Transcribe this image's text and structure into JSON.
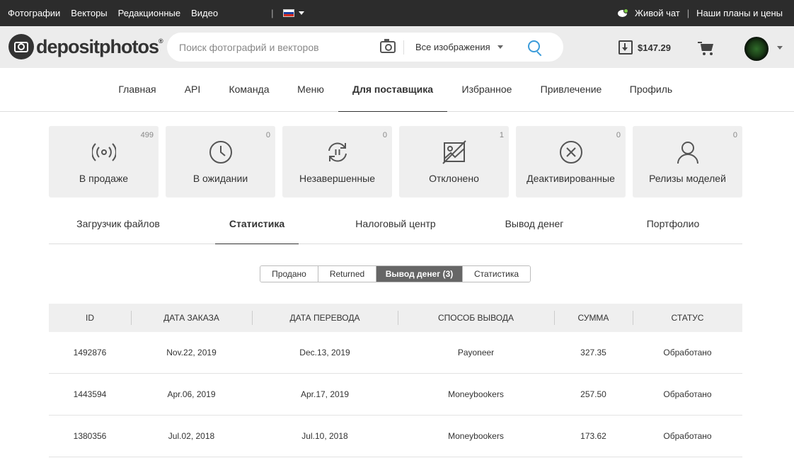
{
  "topbar": {
    "links": [
      "Фотографии",
      "Векторы",
      "Редакционные",
      "Видео"
    ],
    "chat_label": "Живой чат",
    "plans_label": "Наши планы и цены"
  },
  "header": {
    "logo_text": "depositphotos",
    "logo_reg": "®",
    "search_placeholder": "Поиск фотографий и векторов",
    "filter_label": "Все изображения",
    "balance": "$147.29"
  },
  "main_nav": [
    "Главная",
    "API",
    "Команда",
    "Меню",
    "Для поставщика",
    "Избранное",
    "Привлечение",
    "Профиль"
  ],
  "main_nav_active": "Для поставщика",
  "cards": [
    {
      "label": "В продаже",
      "count": "499",
      "icon": "broadcast-icon"
    },
    {
      "label": "В ожидании",
      "count": "0",
      "icon": "clock-icon"
    },
    {
      "label": "Незавершенные",
      "count": "0",
      "icon": "sync-pause-icon"
    },
    {
      "label": "Отклонено",
      "count": "1",
      "icon": "rejected-image-icon"
    },
    {
      "label": "Деактивированные",
      "count": "0",
      "icon": "close-circle-icon"
    },
    {
      "label": "Релизы моделей",
      "count": "0",
      "icon": "user-icon"
    }
  ],
  "sub_tabs": [
    "Загрузчик файлов",
    "Статистика",
    "Налоговый центр",
    "Вывод денег",
    "Портфолио"
  ],
  "sub_tab_active": "Статистика",
  "segments": [
    "Продано",
    "Returned",
    "Вывод денег (3)",
    "Статистика"
  ],
  "segment_active": "Вывод денег (3)",
  "table": {
    "columns": [
      "ID",
      "Дата заказа",
      "Дата перевода",
      "Способ вывода",
      "Сумма",
      "Статус"
    ],
    "rows": [
      [
        "1492876",
        "Nov.22, 2019",
        "Dec.13, 2019",
        "Payoneer",
        "327.35",
        "Обработано"
      ],
      [
        "1443594",
        "Apr.06, 2019",
        "Apr.17, 2019",
        "Moneybookers",
        "257.50",
        "Обработано"
      ],
      [
        "1380356",
        "Jul.02, 2018",
        "Jul.10, 2018",
        "Moneybookers",
        "173.62",
        "Обработано"
      ]
    ]
  },
  "colors": {
    "topbar_bg": "#2c2c2c",
    "header_bg": "#ececec",
    "accent_blue": "#3a9bd9",
    "card_bg": "#efefef",
    "segment_active_bg": "#666666",
    "chat_green": "#7ac943"
  }
}
